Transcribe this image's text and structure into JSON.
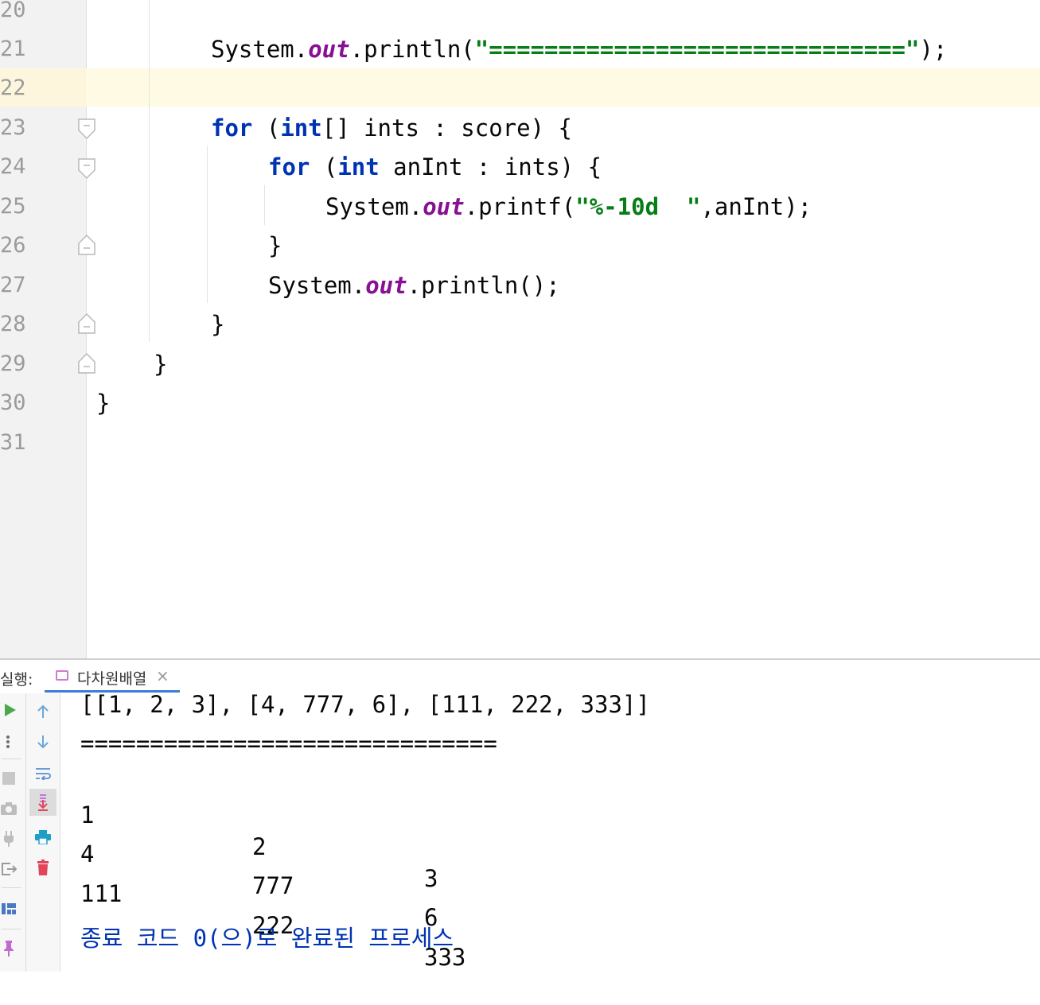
{
  "editor": {
    "line_numbers": [
      "20",
      "21",
      "22",
      "23",
      "24",
      "25",
      "26",
      "27",
      "28",
      "29",
      "30",
      "31"
    ],
    "code": {
      "l21_a": "System.",
      "l21_b": "out",
      "l21_c": ".println(",
      "l21_d": "\"==============================\"",
      "l21_e": ");",
      "l23_a": "for",
      "l23_b": " (",
      "l23_c": "int",
      "l23_d": "[] ints : score) {",
      "l24_a": "for",
      "l24_b": " (",
      "l24_c": "int",
      "l24_d": " anInt : ints) {",
      "l25_a": "System.",
      "l25_b": "out",
      "l25_c": ".printf(",
      "l25_d": "\"%-10d  \"",
      "l25_e": ",anInt);",
      "l26": "}",
      "l27_a": "System.",
      "l27_b": "out",
      "l27_c": ".println();",
      "l28": "}",
      "l29": "}",
      "l30": "}"
    }
  },
  "run_panel": {
    "label": "실행:",
    "tab_name": "다차원배열",
    "tab_close": "×",
    "console": {
      "array_line": "[[1, 2, 3], [4, 777, 6], [111, 222, 333]]",
      "separator": "==============================",
      "rows": [
        [
          "1",
          "2",
          "3"
        ],
        [
          "4",
          "777",
          "6"
        ],
        [
          "111",
          "222",
          "333"
        ]
      ],
      "exit_message": "종료 코드 0(으)로 완료된 프로세스"
    }
  },
  "colors": {
    "keyword": "#0033b3",
    "field": "#871094",
    "string": "#067d17",
    "current_line": "#fefae3"
  }
}
